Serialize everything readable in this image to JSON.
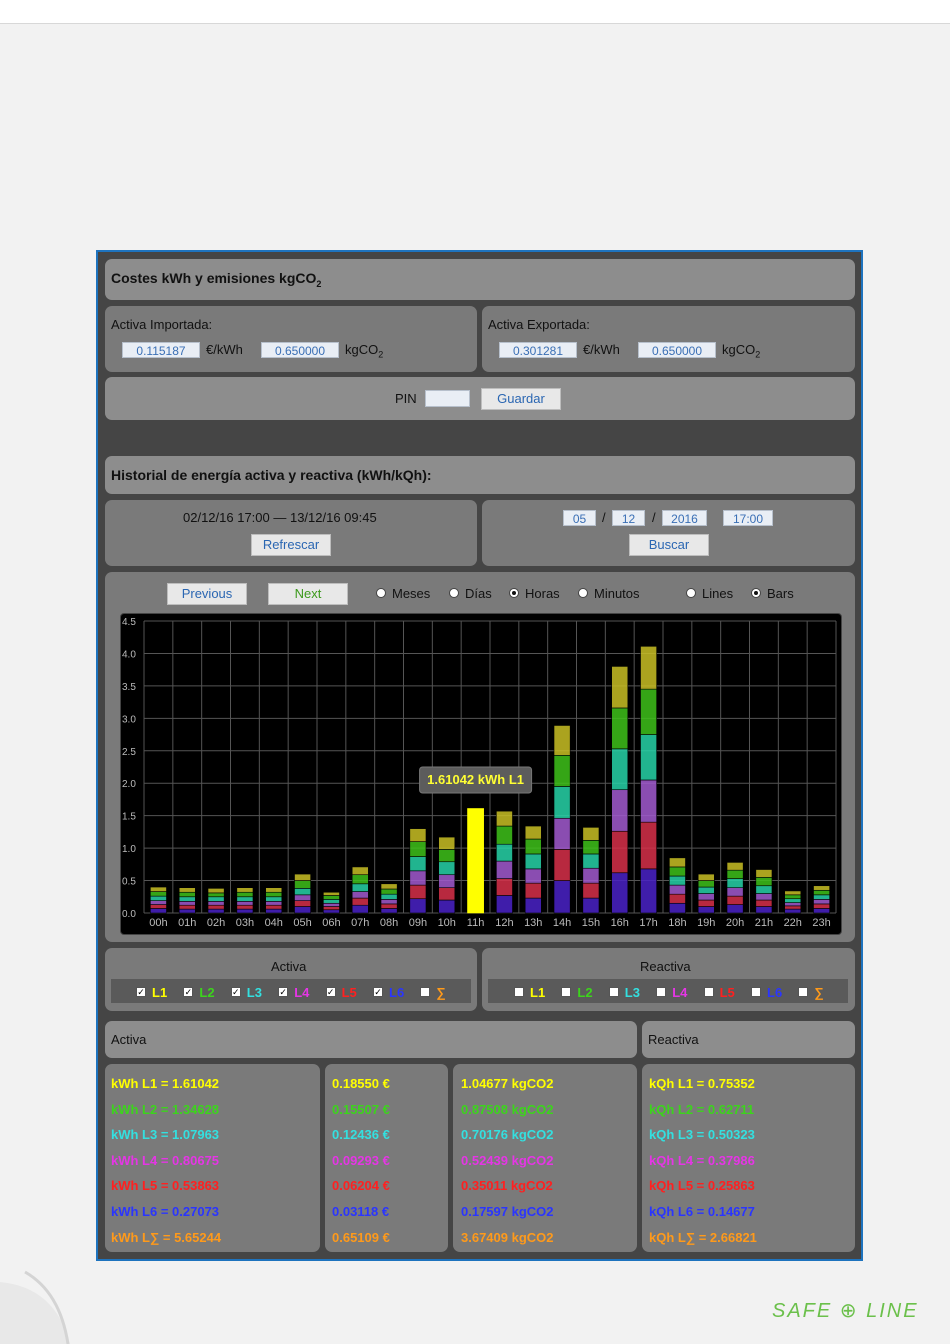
{
  "costs": {
    "title": "Costes kWh y emisiones kgCO",
    "title_sub": "2",
    "imported": {
      "label": "Activa Importada:",
      "price": "0.115187",
      "price_unit": "€/kWh",
      "emission": "0.650000",
      "emission_unit": "kgCO",
      "emission_sub": "2"
    },
    "exported": {
      "label": "Activa Exportada:",
      "price": "0.301281",
      "price_unit": "€/kWh",
      "emission": "0.650000",
      "emission_unit": "kgCO",
      "emission_sub": "2"
    },
    "pin_label": "PIN",
    "pin_value": "",
    "save_label": "Guardar"
  },
  "history": {
    "title": "Historial de energía activa y reactiva (kWh/kQh):",
    "range_text": "02/12/16 17:00 — 13/12/16 09:45",
    "refresh_label": "Refrescar",
    "date": {
      "day": "05",
      "month": "12",
      "year": "2016",
      "time": "17:00",
      "sep": "/"
    },
    "search_label": "Buscar"
  },
  "controls": {
    "previous_label": "Previous",
    "next_label": "Next",
    "periods": [
      {
        "label": "Meses",
        "selected": false
      },
      {
        "label": "Días",
        "selected": false
      },
      {
        "label": "Horas",
        "selected": true
      },
      {
        "label": "Minutos",
        "selected": false
      }
    ],
    "modes": [
      {
        "label": "Lines",
        "selected": false
      },
      {
        "label": "Bars",
        "selected": true
      }
    ]
  },
  "chart_data": {
    "type": "bar",
    "stacked": true,
    "categories": [
      "00h",
      "01h",
      "02h",
      "03h",
      "04h",
      "05h",
      "06h",
      "07h",
      "08h",
      "09h",
      "10h",
      "11h",
      "12h",
      "13h",
      "14h",
      "15h",
      "16h",
      "17h",
      "18h",
      "19h",
      "20h",
      "21h",
      "22h",
      "23h"
    ],
    "ylim": [
      0,
      4.5
    ],
    "yticks": [
      "0.0",
      "0.5",
      "1.0",
      "1.5",
      "2.0",
      "2.5",
      "3.0",
      "3.5",
      "4.0",
      "4.5"
    ],
    "series": [
      {
        "name": "L6",
        "color": "#4a22c8",
        "values": [
          0.07,
          0.06,
          0.06,
          0.06,
          0.06,
          0.1,
          0.05,
          0.12,
          0.07,
          0.22,
          0.2,
          0,
          0.27,
          0.23,
          0.5,
          0.23,
          0.62,
          0.68,
          0.15,
          0.1,
          0.13,
          0.1,
          0.06,
          0.07
        ]
      },
      {
        "name": "L5",
        "color": "#d8304a",
        "values": [
          0.06,
          0.06,
          0.06,
          0.06,
          0.06,
          0.09,
          0.05,
          0.11,
          0.07,
          0.21,
          0.19,
          0,
          0.26,
          0.23,
          0.48,
          0.23,
          0.64,
          0.72,
          0.14,
          0.1,
          0.13,
          0.1,
          0.05,
          0.07
        ]
      },
      {
        "name": "L4",
        "color": "#a25ad0",
        "values": [
          0.06,
          0.06,
          0.06,
          0.06,
          0.06,
          0.09,
          0.05,
          0.1,
          0.07,
          0.22,
          0.2,
          0,
          0.27,
          0.22,
          0.48,
          0.23,
          0.64,
          0.65,
          0.14,
          0.1,
          0.13,
          0.1,
          0.05,
          0.07
        ]
      },
      {
        "name": "L3",
        "color": "#27d4a8",
        "values": [
          0.07,
          0.07,
          0.07,
          0.07,
          0.07,
          0.1,
          0.06,
          0.12,
          0.08,
          0.22,
          0.2,
          0,
          0.26,
          0.23,
          0.49,
          0.22,
          0.63,
          0.7,
          0.14,
          0.1,
          0.14,
          0.12,
          0.06,
          0.07
        ]
      },
      {
        "name": "L2",
        "color": "#3ec21a",
        "values": [
          0.07,
          0.07,
          0.06,
          0.07,
          0.07,
          0.12,
          0.06,
          0.14,
          0.08,
          0.23,
          0.19,
          0,
          0.28,
          0.23,
          0.48,
          0.21,
          0.63,
          0.7,
          0.14,
          0.1,
          0.13,
          0.13,
          0.06,
          0.07
        ]
      },
      {
        "name": "L1",
        "color": "#c9bf24",
        "values": [
          0.07,
          0.07,
          0.07,
          0.07,
          0.07,
          0.1,
          0.05,
          0.12,
          0.08,
          0.2,
          0.19,
          1.61042,
          0.23,
          0.2,
          0.46,
          0.2,
          0.64,
          0.66,
          0.14,
          0.1,
          0.12,
          0.12,
          0.06,
          0.07
        ]
      }
    ],
    "highlight": {
      "category": "11h",
      "series": "L1",
      "color": "#ffff00"
    },
    "tooltip": "1.61042 kWh L1"
  },
  "filters": {
    "active": {
      "title": "Activa",
      "items": [
        {
          "label": "L1",
          "checked": true,
          "color": "#ffff00"
        },
        {
          "label": "L2",
          "checked": true,
          "color": "#3cd41c"
        },
        {
          "label": "L3",
          "checked": true,
          "color": "#33e0e0"
        },
        {
          "label": "L4",
          "checked": true,
          "color": "#e535e5"
        },
        {
          "label": "L5",
          "checked": true,
          "color": "#ff2020"
        },
        {
          "label": "L6",
          "checked": true,
          "color": "#2a35ff"
        },
        {
          "label": "∑",
          "checked": false,
          "color": "#ff9a1a"
        }
      ]
    },
    "reactive": {
      "title": "Reactiva",
      "items": [
        {
          "label": "L1",
          "checked": false,
          "color": "#ffff00"
        },
        {
          "label": "L2",
          "checked": false,
          "color": "#3cd41c"
        },
        {
          "label": "L3",
          "checked": false,
          "color": "#33e0e0"
        },
        {
          "label": "L4",
          "checked": false,
          "color": "#e535e5"
        },
        {
          "label": "L5",
          "checked": false,
          "color": "#ff2020"
        },
        {
          "label": "L6",
          "checked": false,
          "color": "#2a35ff"
        },
        {
          "label": "∑",
          "checked": false,
          "color": "#ff9a1a"
        }
      ]
    }
  },
  "summary": {
    "active_title": "Activa",
    "reactive_title": "Reactiva",
    "rows": [
      {
        "color": "#ffff00",
        "kwh": "kWh L1 = 1.61042",
        "cost": "0.18550 €",
        "co2": "1.04677 kgCO2",
        "kqh": "kQh L1 = 0.75352"
      },
      {
        "color": "#3cd41c",
        "kwh": "kWh L2 = 1.34628",
        "cost": "0.15507 €",
        "co2": "0.87508 kgCO2",
        "kqh": "kQh L2 = 0.62711"
      },
      {
        "color": "#33e0e0",
        "kwh": "kWh L3 = 1.07963",
        "cost": "0.12436 €",
        "co2": "0.70176 kgCO2",
        "kqh": "kQh L3 = 0.50323"
      },
      {
        "color": "#e535e5",
        "kwh": "kWh L4 = 0.80675",
        "cost": "0.09293 €",
        "co2": "0.52439 kgCO2",
        "kqh": "kQh L4 = 0.37986"
      },
      {
        "color": "#ff2020",
        "kwh": "kWh L5 = 0.53863",
        "cost": "0.06204 €",
        "co2": "0.35011 kgCO2",
        "kqh": "kQh L5 = 0.25863"
      },
      {
        "color": "#2a35ff",
        "kwh": "kWh L6 = 0.27073",
        "cost": "0.03118 €",
        "co2": "0.17597 kgCO2",
        "kqh": "kQh L6 = 0.14677"
      },
      {
        "color": "#ff9a1a",
        "kwh": "kWh L∑ = 5.65244",
        "cost": "0.65109 €",
        "co2": "3.67409 kgCO2",
        "kqh": "kQh L∑ = 2.66821"
      }
    ]
  },
  "brand": {
    "logo_text": "SAFE ⊕ LINE"
  }
}
